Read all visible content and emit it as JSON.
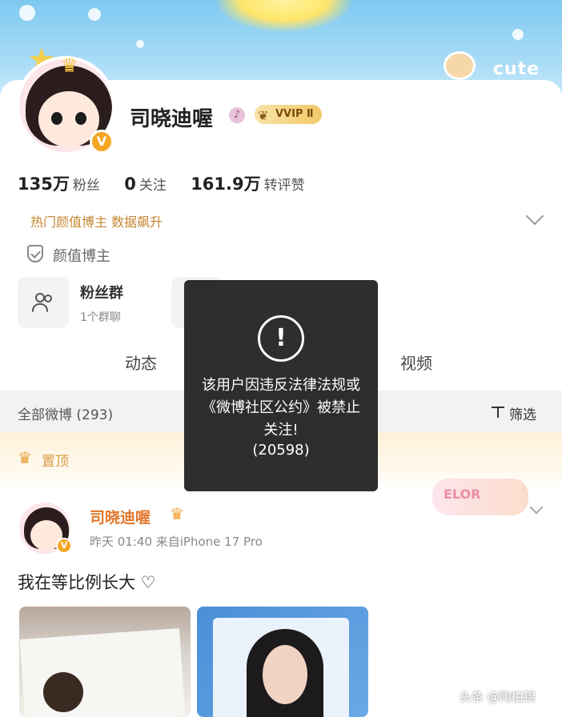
{
  "header": {
    "cute_label": "cute"
  },
  "profile": {
    "username": "司晓迪喔",
    "vip_badge": "VVIP Ⅱ",
    "verified_badge": "V",
    "stats": [
      {
        "value": "135万",
        "label": "粉丝"
      },
      {
        "value": "0",
        "label": "关注"
      },
      {
        "value": "161.9万",
        "label": "转评赞"
      }
    ],
    "tagline": "热门颜值博主 数据飙升",
    "creator_tag": "颜值博主",
    "fan_group": {
      "title": "粉丝群",
      "subtitle": "1个群聊"
    }
  },
  "tabs": [
    {
      "label": "动态"
    },
    {
      "label": "视频"
    }
  ],
  "filter_bar": {
    "all_posts": "全部微博 (293)",
    "filter_label": "筛选"
  },
  "pinned": {
    "label": "置顶",
    "sticker_text": "ELOR"
  },
  "post": {
    "author": "司晓迪喔",
    "meta": "昨天 01:40  来自iPhone 17 Pro",
    "text": "我在等比例长大 ♡"
  },
  "dialog": {
    "icon": "!",
    "message": "该用户因违反法律法规或《微博社区公约》被禁止关注!",
    "code": "(20598)"
  },
  "watermark": "头条 @陶柏锦",
  "icons": {
    "alert": "alert-icon",
    "filter": "filter-icon",
    "shield": "shield-icon",
    "people": "people-icon",
    "crown": "crown-icon"
  },
  "colors": {
    "accent_orange": "#e2772c",
    "tagline_gold": "#c5862f",
    "vip_gold": "#f2c969",
    "dialog_bg": "#1c1c1c"
  }
}
